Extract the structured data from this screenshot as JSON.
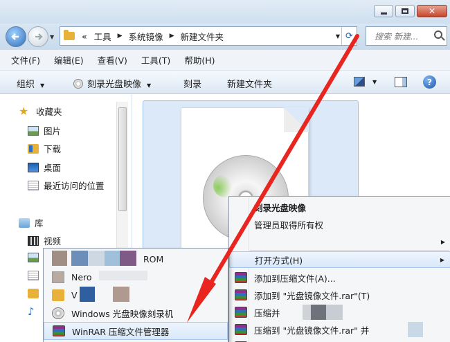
{
  "address": {
    "history": "«",
    "crumbs": [
      "工具",
      "系统镜像",
      "新建文件夹"
    ],
    "search_placeholder": "搜索 新建..."
  },
  "menubar": [
    "文件(F)",
    "编辑(E)",
    "查看(V)",
    "工具(T)",
    "帮助(H)"
  ],
  "cmdbar": {
    "organize": "组织",
    "burn_image": "刻录光盘映像",
    "burn": "刻录",
    "new_folder": "新建文件夹"
  },
  "nav": {
    "favorites": "收藏夹",
    "pictures": "图片",
    "downloads": "下载",
    "desktop": "桌面",
    "recent": "最近访问的位置",
    "libraries": "库",
    "videos": "视频"
  },
  "context_menu": {
    "burn_disc_image": "刻录光盘映像",
    "take_ownership": "管理员取得所有权",
    "open_with": "打开方式(H)",
    "add_to_archive": "添加到压缩文件(A)...",
    "add_to_rar": "添加到 \"光盘镜像文件.rar\"(T)",
    "compress_and": "压缩并",
    "compress_to_rar": "压缩到 \"光盘镜像文件.rar\" 并"
  },
  "open_with_menu": {
    "item_rom": "ROM",
    "item_nero": "Nero",
    "item_v": "V",
    "windows_burner": "Windows 光盘映像刻录机",
    "winrar": "WinRAR 压缩文件管理器"
  },
  "colors": {
    "arrow": "#e8261f",
    "highlight": "#d9e8fa",
    "selection": "#dbe9f9"
  }
}
